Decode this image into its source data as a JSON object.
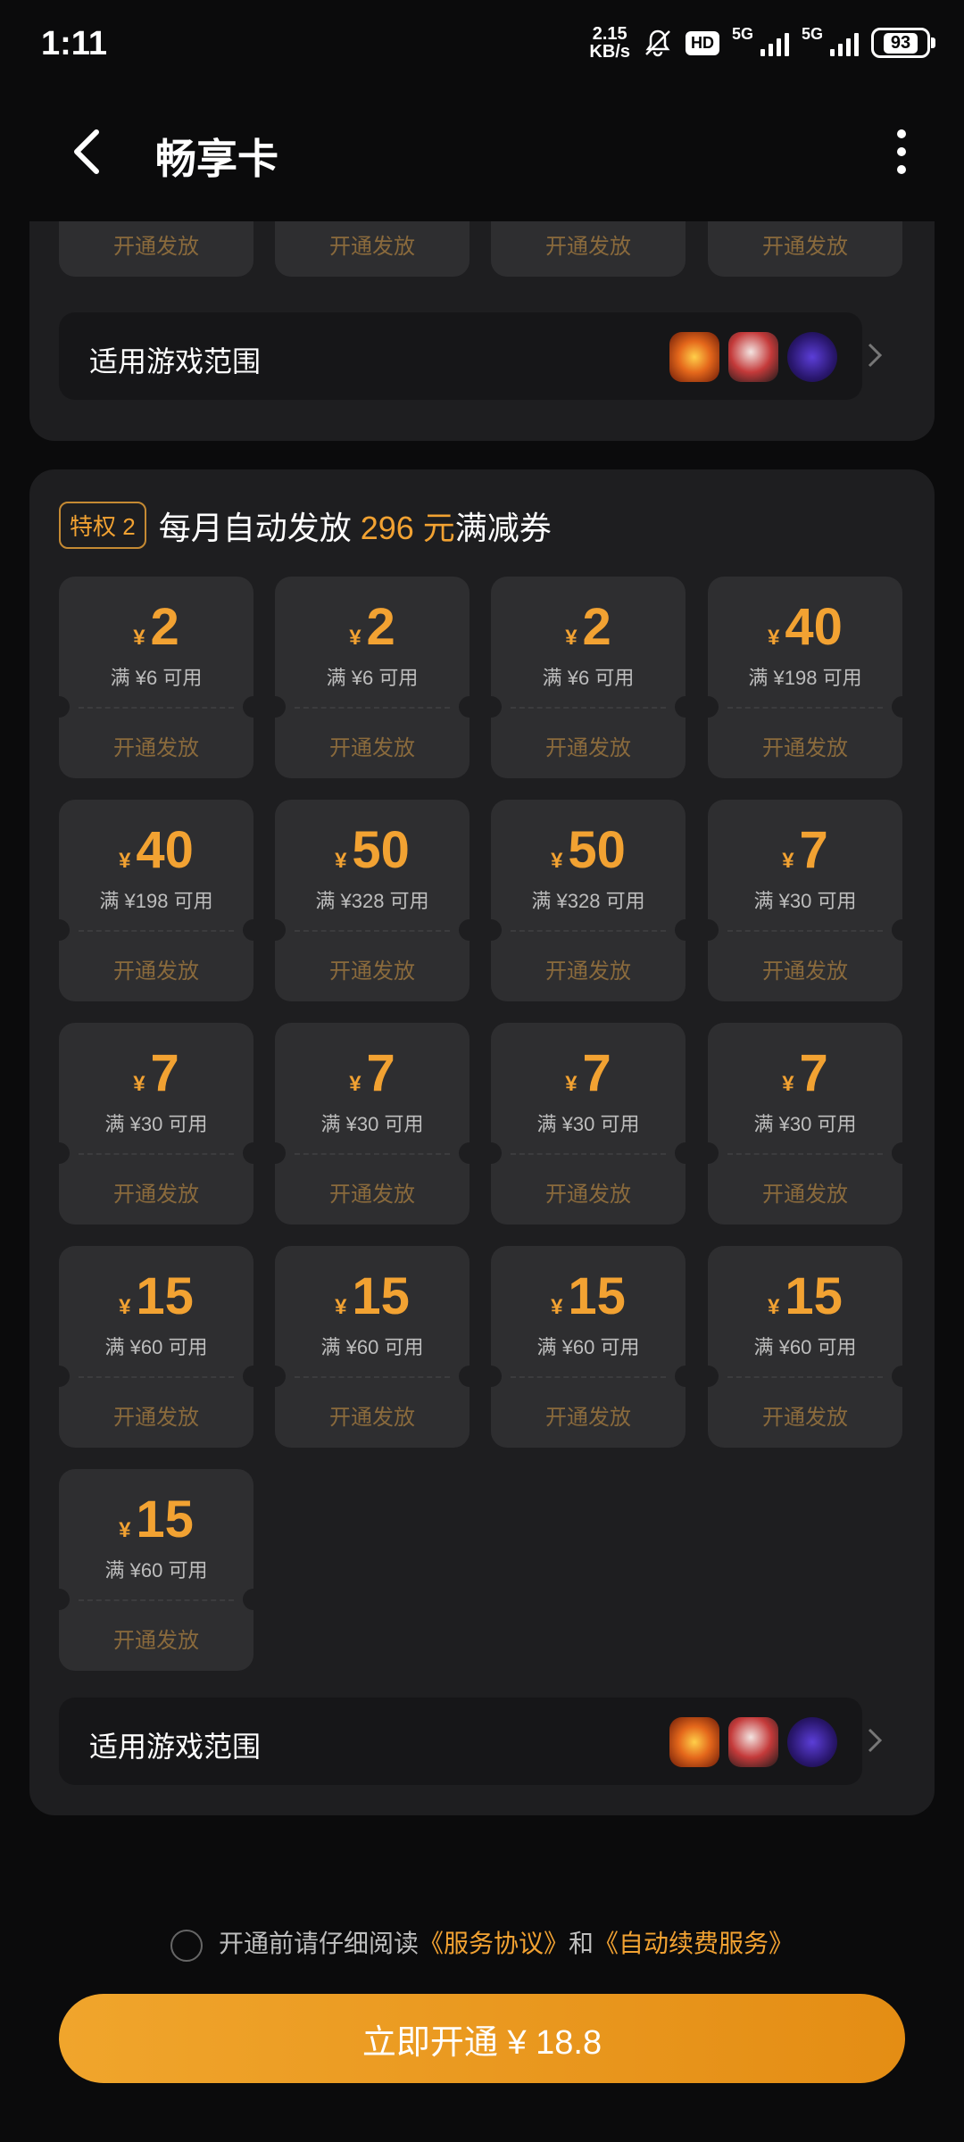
{
  "status_bar": {
    "time": "1:11",
    "net_speed_value": "2.15",
    "net_speed_unit": "KB/s",
    "hd_label": "HD",
    "sim1": "5G",
    "sim2": "5G",
    "battery": "93"
  },
  "header": {
    "title": "畅享卡"
  },
  "section1": {
    "coupon_buttons": [
      "开通发放",
      "开通发放",
      "开通发放",
      "开通发放"
    ],
    "games_label": "适用游戏范围",
    "game_icons": [
      "game-icon-1",
      "game-icon-2",
      "game-icon-3"
    ]
  },
  "section2": {
    "tag": "特权 2",
    "heading_prefix": "每月自动发放 ",
    "heading_amount": "296 元",
    "heading_suffix": "满减券",
    "currency": "¥",
    "coupons": [
      {
        "amount": "2",
        "condition": "满 ¥6 可用",
        "button": "开通发放"
      },
      {
        "amount": "2",
        "condition": "满 ¥6 可用",
        "button": "开通发放"
      },
      {
        "amount": "2",
        "condition": "满 ¥6 可用",
        "button": "开通发放"
      },
      {
        "amount": "40",
        "condition": "满 ¥198 可用",
        "button": "开通发放"
      },
      {
        "amount": "40",
        "condition": "满 ¥198 可用",
        "button": "开通发放"
      },
      {
        "amount": "50",
        "condition": "满 ¥328 可用",
        "button": "开通发放"
      },
      {
        "amount": "50",
        "condition": "满 ¥328 可用",
        "button": "开通发放"
      },
      {
        "amount": "7",
        "condition": "满 ¥30 可用",
        "button": "开通发放"
      },
      {
        "amount": "7",
        "condition": "满 ¥30 可用",
        "button": "开通发放"
      },
      {
        "amount": "7",
        "condition": "满 ¥30 可用",
        "button": "开通发放"
      },
      {
        "amount": "7",
        "condition": "满 ¥30 可用",
        "button": "开通发放"
      },
      {
        "amount": "7",
        "condition": "满 ¥30 可用",
        "button": "开通发放"
      },
      {
        "amount": "15",
        "condition": "满 ¥60 可用",
        "button": "开通发放"
      },
      {
        "amount": "15",
        "condition": "满 ¥60 可用",
        "button": "开通发放"
      },
      {
        "amount": "15",
        "condition": "满 ¥60 可用",
        "button": "开通发放"
      },
      {
        "amount": "15",
        "condition": "满 ¥60 可用",
        "button": "开通发放"
      },
      {
        "amount": "15",
        "condition": "满 ¥60 可用",
        "button": "开通发放"
      }
    ],
    "games_label": "适用游戏范围"
  },
  "agreement": {
    "prefix": "开通前请仔细阅读",
    "link1": "《服务协议》",
    "middle": "和",
    "link2": "《自动续费服务》"
  },
  "cta": {
    "label": "立即开通 ¥ 18.8"
  },
  "colors": {
    "accent": "#f2a232",
    "panel": "#1e1e20",
    "coupon": "#2e2e30"
  }
}
